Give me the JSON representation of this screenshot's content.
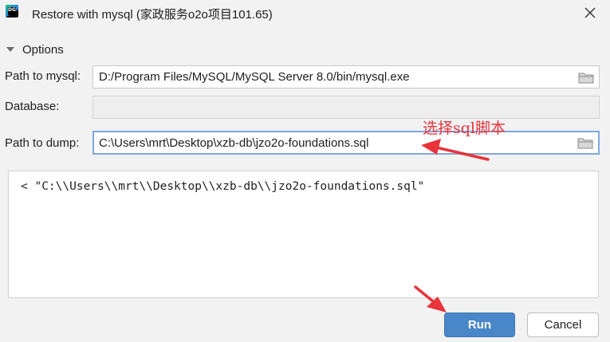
{
  "window": {
    "app_icon_text": "DG",
    "title": "Restore with mysql (家政服务o2o项目101.65)"
  },
  "options": {
    "section_label": "Options",
    "path_to_mysql": {
      "label": "Path to mysql:",
      "value": "D:/Program Files/MySQL/MySQL Server 8.0/bin/mysql.exe"
    },
    "database": {
      "label": "Database:",
      "value": ""
    },
    "path_to_dump": {
      "label": "Path to dump:",
      "value": "C:\\Users\\mrt\\Desktop\\xzb-db\\jzo2o-foundations.sql"
    }
  },
  "command_preview": "< \"C:\\\\Users\\\\mrt\\\\Desktop\\\\xzb-db\\\\jzo2o-foundations.sql\"",
  "annotation_text": "选择sql脚本",
  "buttons": {
    "run": "Run",
    "cancel": "Cancel"
  },
  "colors": {
    "accent": "#4a87c9",
    "annotation": "#e8343a",
    "focus_border": "#7fa8de"
  }
}
